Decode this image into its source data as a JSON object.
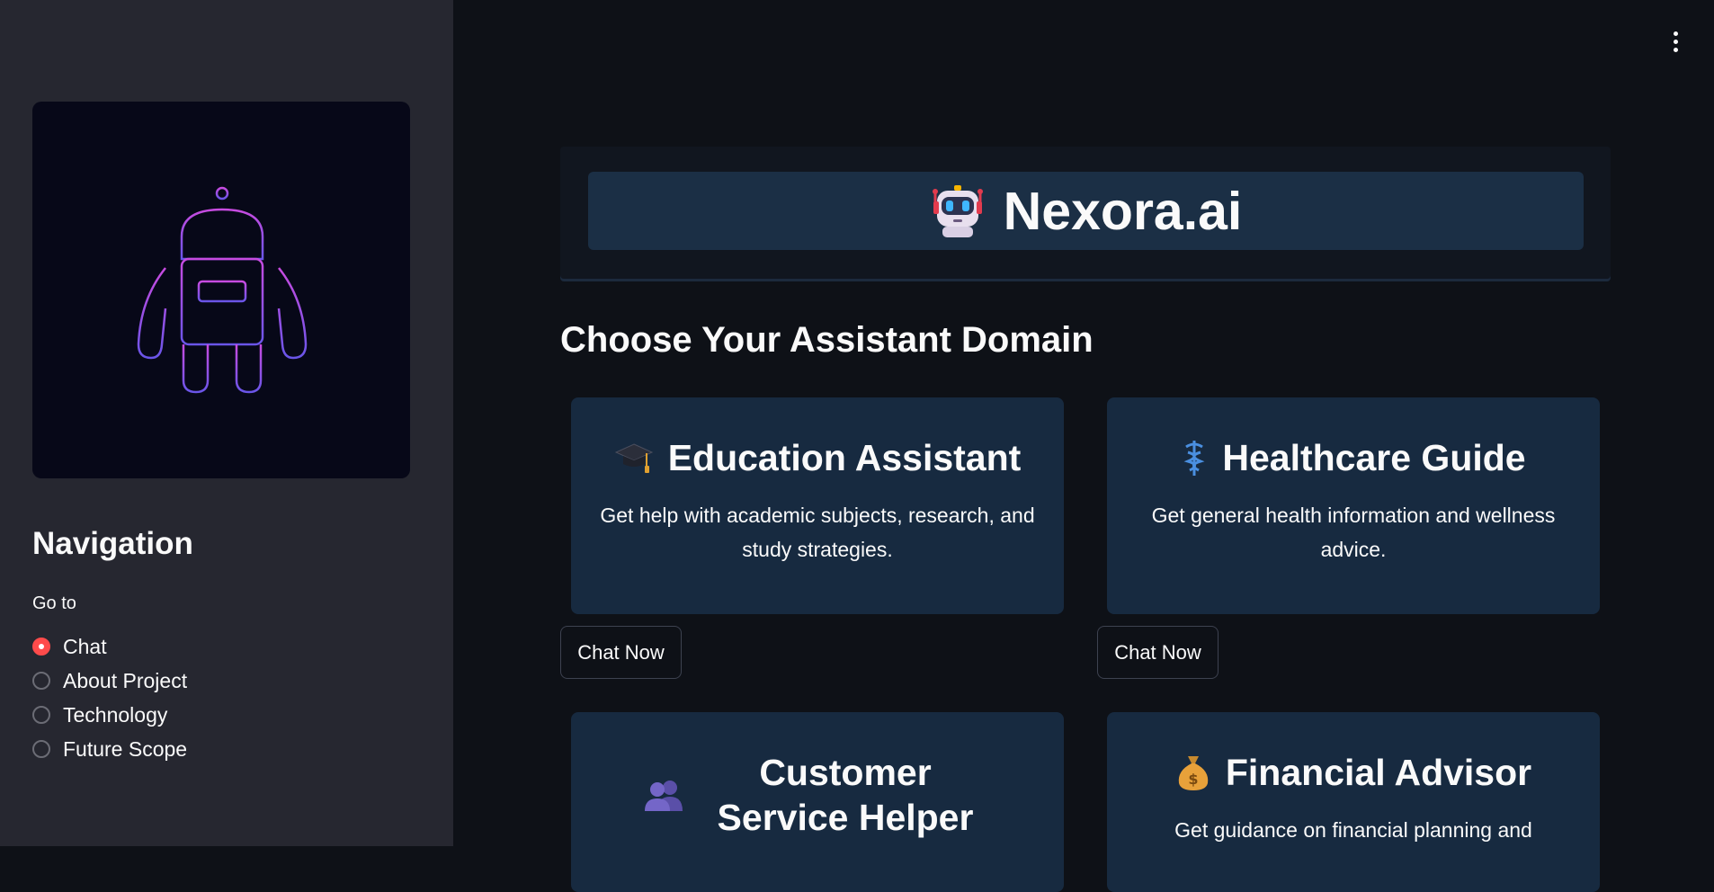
{
  "sidebar": {
    "logo_icon": "robot-outline-logo",
    "nav_title": "Navigation",
    "goto_label": "Go to",
    "radio_options": [
      "Chat",
      "About Project",
      "Technology",
      "Future Scope"
    ],
    "selected_option": "Chat"
  },
  "header": {
    "brand_icon": "robot-face-icon",
    "brand_name": "Nexora.ai"
  },
  "main": {
    "section_title": "Choose Your Assistant Domain",
    "cards": [
      {
        "icon": "graduation-cap-icon",
        "title": "Education Assistant",
        "description": "Get help with academic subjects, research, and study strategies.",
        "button": "Chat Now"
      },
      {
        "icon": "caduceus-icon",
        "title": "Healthcare Guide",
        "description": "Get general health information and wellness advice.",
        "button": "Chat Now"
      },
      {
        "icon": "people-icon",
        "title": "Customer Service Helper",
        "description": "",
        "button": ""
      },
      {
        "icon": "money-bag-icon",
        "title": "Financial Advisor",
        "description": "Get guidance on financial planning and",
        "button": ""
      }
    ]
  },
  "colors": {
    "sidebar_bg": "#262730",
    "main_bg": "#0e1117",
    "card_bg": "#172a40",
    "radio_active": "#ff4b4b"
  }
}
